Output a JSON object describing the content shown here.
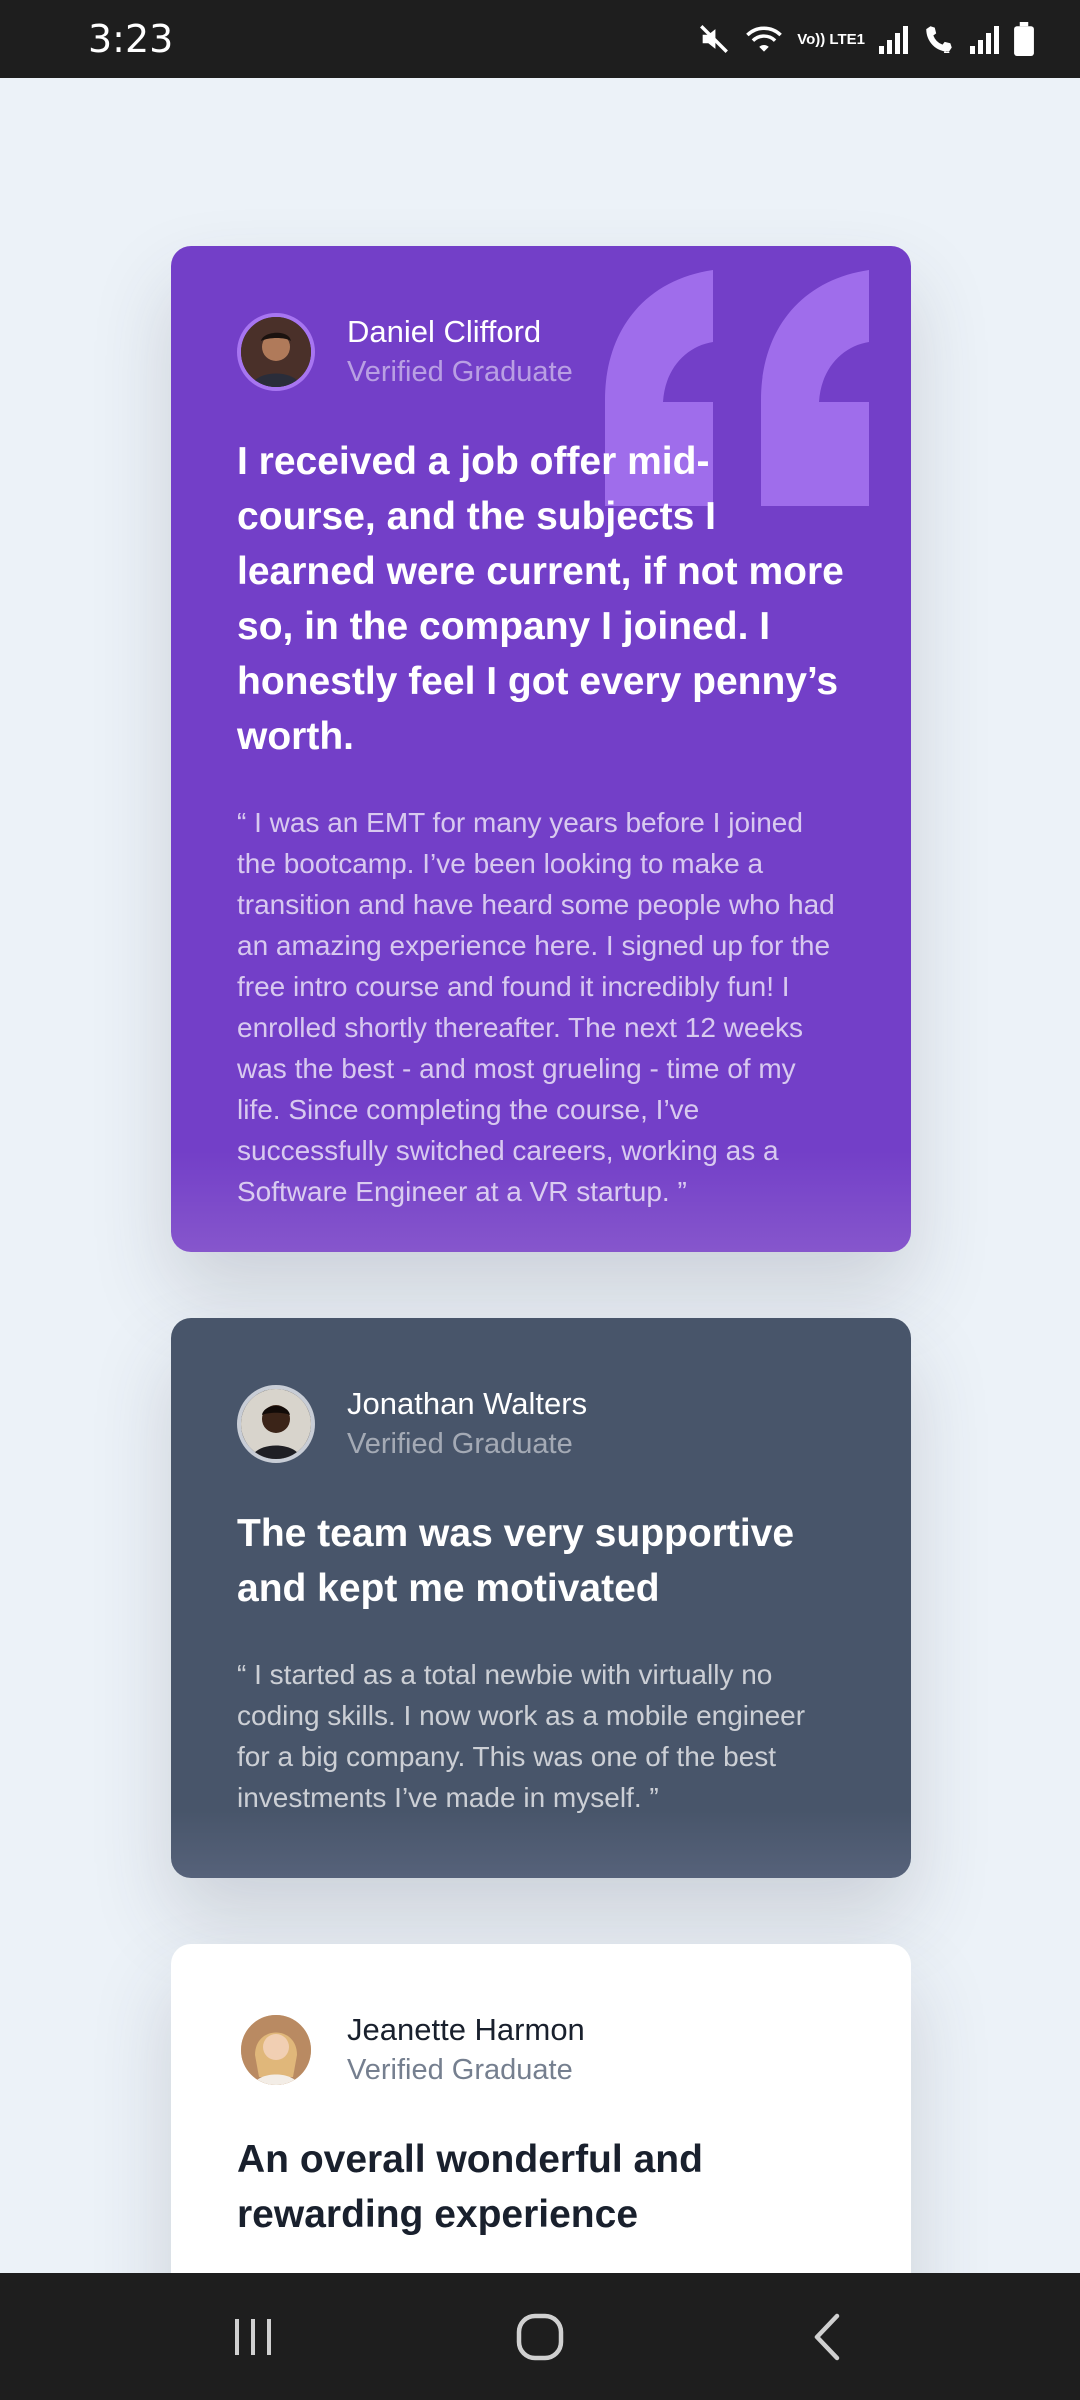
{
  "status_bar": {
    "time": "3:23",
    "network_label": "Vo)) LTE1",
    "icons": [
      "mute-icon",
      "wifi-icon",
      "signal-icon",
      "wifi-calling-icon",
      "signal-icon",
      "battery-icon"
    ]
  },
  "testimonials": [
    {
      "name": "Daniel Clifford",
      "role": "Verified Graduate",
      "headline": "I received a job offer mid-course, and the subjects I learned were current, if not more so, in the company I joined. I honestly feel I got every penny’s worth.",
      "body": "“ I was an EMT for many years before I joined the bootcamp. I’ve been looking to make a transition and have heard some people who had an amazing experience here. I signed up for the free intro course and found it incredibly fun! I enrolled shortly thereafter. The next 12 weeks was the best - and most grueling - time of my life. Since completing the course, I’ve successfully switched careers, working as a Software Engineer at a VR startup. ”",
      "color": "#733fc8"
    },
    {
      "name": "Jonathan Walters",
      "role": "Verified Graduate",
      "headline": "The team was very supportive and kept me motivated",
      "body": "“ I started as a total newbie with virtually no coding skills. I now work as a mobile engineer for a big company. This was one of the best investments I’ve made in myself. ”",
      "color": "#48556a"
    },
    {
      "name": "Jeanette Harmon",
      "role": "Verified Graduate",
      "headline": "An overall wonderful and rewarding experience",
      "color": "#ffffff"
    }
  ],
  "colors": {
    "background": "#ecf2f8",
    "quote_mark": "#a775f1",
    "system_bar": "#1e1e1e"
  },
  "nav_bar": {
    "icons": [
      "recent-apps-icon",
      "home-icon",
      "back-icon"
    ]
  }
}
